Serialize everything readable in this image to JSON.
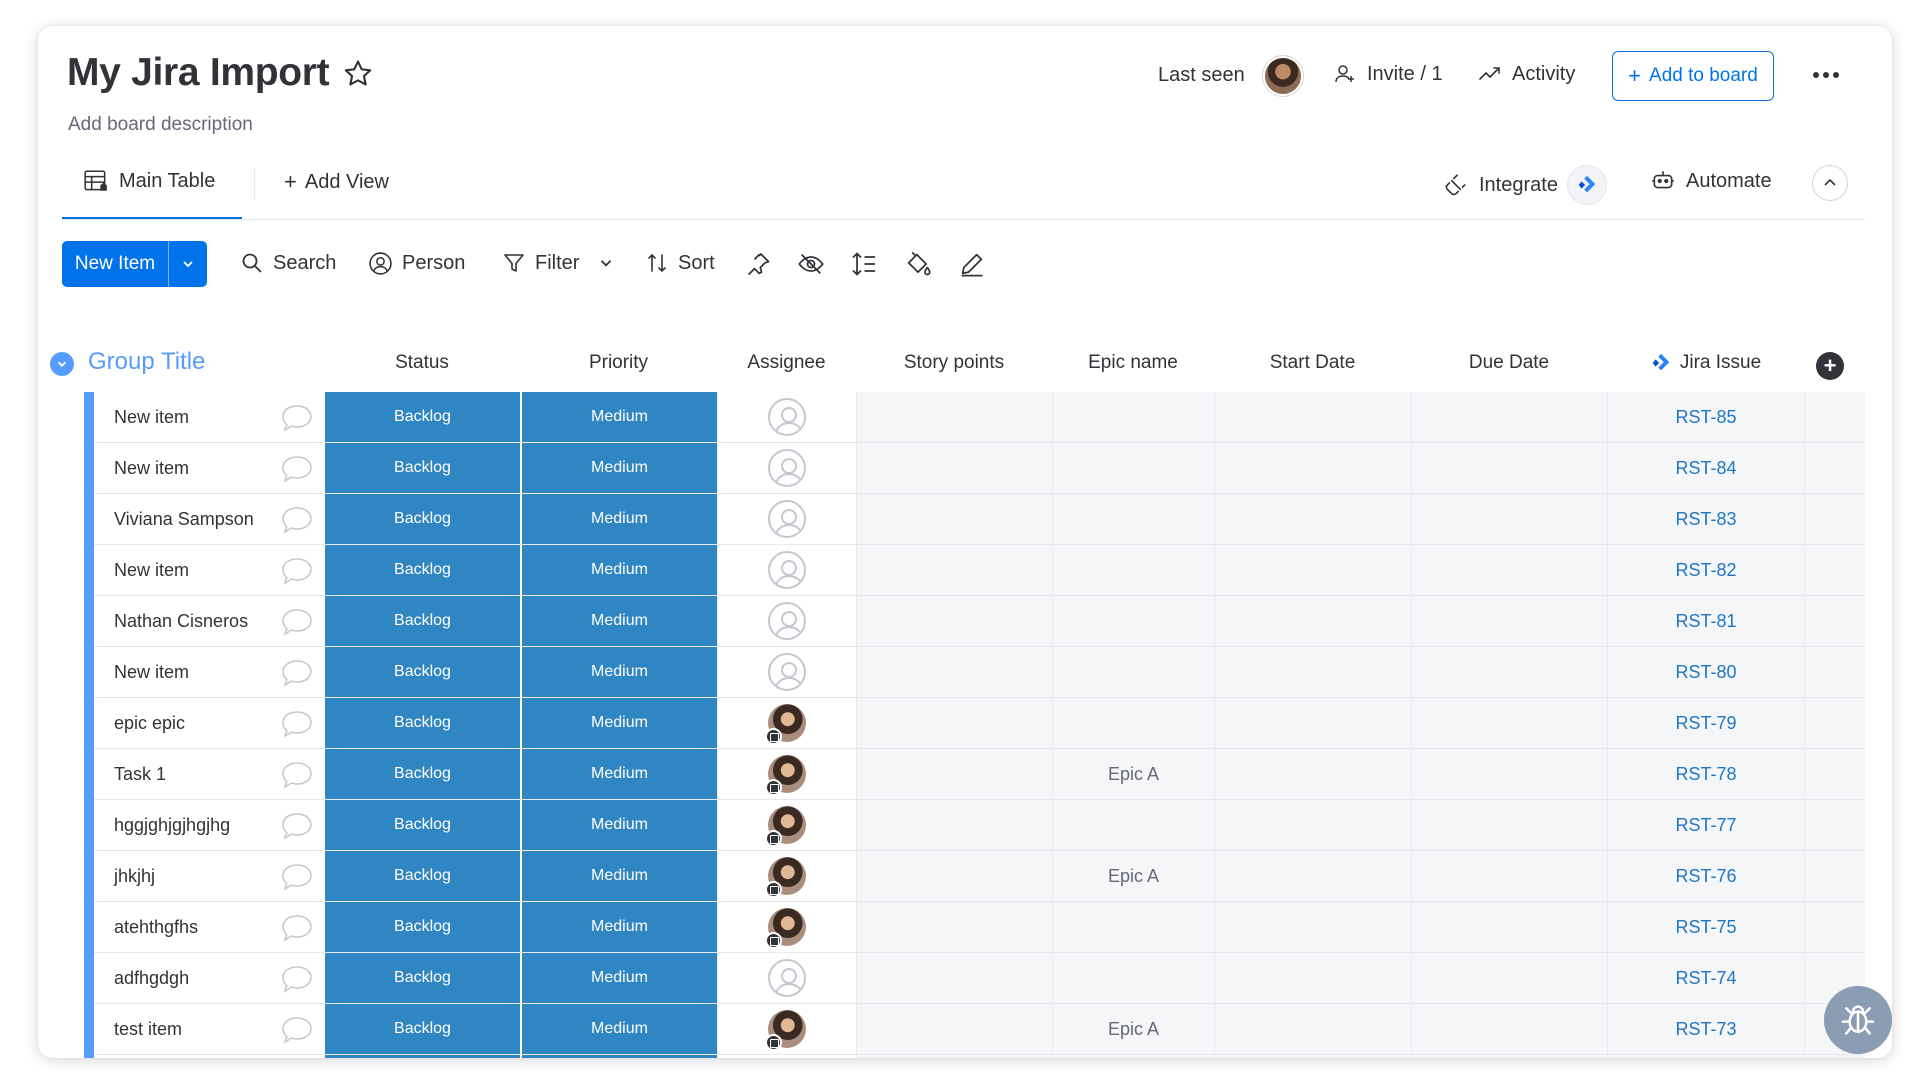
{
  "header": {
    "title": "My Jira Import",
    "description": "Add board description",
    "last_seen_label": "Last seen",
    "invite_label": "Invite / 1",
    "activity_label": "Activity",
    "add_to_board_label": "Add to board"
  },
  "views": {
    "main_table_label": "Main Table",
    "add_view_label": "Add View",
    "integrate_label": "Integrate",
    "automate_label": "Automate"
  },
  "toolbar": {
    "new_item_label": "New Item",
    "search_label": "Search",
    "person_label": "Person",
    "filter_label": "Filter",
    "sort_label": "Sort"
  },
  "group": {
    "title": "Group Title",
    "color": "#579bfc"
  },
  "columns": {
    "status": "Status",
    "priority": "Priority",
    "assignee": "Assignee",
    "story_points": "Story points",
    "epic_name": "Epic name",
    "start_date": "Start Date",
    "due_date": "Due Date",
    "jira_issue": "Jira Issue"
  },
  "colors": {
    "accent": "#0073ea",
    "status_fill": "#2f86c2",
    "link": "#1f76c2"
  },
  "rows": [
    {
      "name": "New item",
      "status": "Backlog",
      "priority": "Medium",
      "assignee": "none",
      "epic": "",
      "jira": "RST-85"
    },
    {
      "name": "New item",
      "status": "Backlog",
      "priority": "Medium",
      "assignee": "none",
      "epic": "",
      "jira": "RST-84"
    },
    {
      "name": "Viviana Sampson",
      "status": "Backlog",
      "priority": "Medium",
      "assignee": "none",
      "epic": "",
      "jira": "RST-83"
    },
    {
      "name": "New item",
      "status": "Backlog",
      "priority": "Medium",
      "assignee": "none",
      "epic": "",
      "jira": "RST-82"
    },
    {
      "name": "Nathan Cisneros",
      "status": "Backlog",
      "priority": "Medium",
      "assignee": "none",
      "epic": "",
      "jira": "RST-81"
    },
    {
      "name": "New item",
      "status": "Backlog",
      "priority": "Medium",
      "assignee": "none",
      "epic": "",
      "jira": "RST-80"
    },
    {
      "name": "epic epic",
      "status": "Backlog",
      "priority": "Medium",
      "assignee": "photo",
      "epic": "",
      "jira": "RST-79"
    },
    {
      "name": "Task 1",
      "status": "Backlog",
      "priority": "Medium",
      "assignee": "photo",
      "epic": "Epic A",
      "jira": "RST-78"
    },
    {
      "name": "hggjghjgjhgjhg",
      "status": "Backlog",
      "priority": "Medium",
      "assignee": "photo",
      "epic": "",
      "jira": "RST-77"
    },
    {
      "name": "jhkjhj",
      "status": "Backlog",
      "priority": "Medium",
      "assignee": "photo",
      "epic": "Epic A",
      "jira": "RST-76"
    },
    {
      "name": "atehthgfhs",
      "status": "Backlog",
      "priority": "Medium",
      "assignee": "photo",
      "epic": "",
      "jira": "RST-75"
    },
    {
      "name": "adfhgdgh",
      "status": "Backlog",
      "priority": "Medium",
      "assignee": "none",
      "epic": "",
      "jira": "RST-74"
    },
    {
      "name": "test item",
      "status": "Backlog",
      "priority": "Medium",
      "assignee": "photo",
      "epic": "Epic A",
      "jira": "RST-73"
    }
  ]
}
